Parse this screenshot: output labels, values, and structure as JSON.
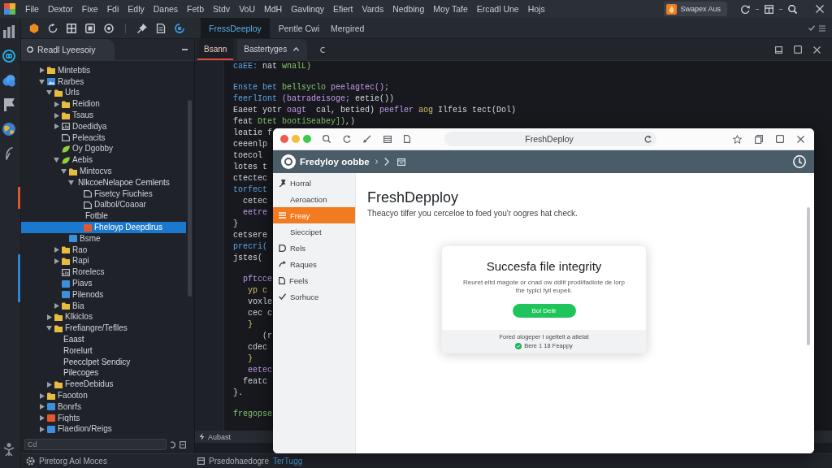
{
  "menubar": {
    "items": [
      "File",
      "Dextor",
      "Fixe",
      "Fdi",
      "Edly",
      "Danes",
      "Fetb",
      "Stdv",
      "VoU",
      "MdH",
      "Gavlinqy",
      "Efiert",
      "Vards",
      "Nedbing",
      "Moy Tafe",
      "Ercadl Une",
      "Hojs"
    ],
    "account": "Swapex Aus"
  },
  "toolbar": {
    "tabs": [
      {
        "label": "FressDeeploy",
        "selected": true
      },
      {
        "label": "Pentle Cwi",
        "selected": false
      },
      {
        "label": "Mergired",
        "selected": false
      }
    ]
  },
  "explorer": {
    "title": "Readl Lyeesoiy",
    "tree": [
      {
        "label": "Mintebtis",
        "kind": "folder",
        "expanded": false,
        "selected": false
      },
      {
        "label": "Rarbes",
        "kind": "image",
        "expanded": true,
        "selected": false,
        "children": [
          {
            "label": "Urls",
            "kind": "folder",
            "expanded": true,
            "selected": false,
            "children": [
              {
                "label": "Reidion",
                "kind": "folder",
                "expanded": false,
                "selected": false
              },
              {
                "label": "Tsaus",
                "kind": "folder",
                "expanded": false,
                "selected": false
              },
              {
                "label": "Doedidya",
                "kind": "chart",
                "expanded": false,
                "selected": false
              },
              {
                "label": "Peleacits",
                "kind": "doc",
                "selected": false
              },
              {
                "label": "Oy Dgobby",
                "kind": "leaf",
                "selected": false
              },
              {
                "label": "Aebis",
                "kind": "leaf",
                "expanded": true,
                "selected": false,
                "children": [
                  {
                    "label": "Mintocvs",
                    "kind": "folder",
                    "expanded": true,
                    "selected": false,
                    "children": [
                      {
                        "label": "NlkcoeNelapoe Cemlents",
                        "kind": "plain",
                        "expanded": true,
                        "selected": false,
                        "children": [
                          {
                            "label": "Fisetcy Fiuchies",
                            "kind": "doc",
                            "selected": false
                          },
                          {
                            "label": "Dalbol/Coaoar",
                            "kind": "doc",
                            "selected": false
                          },
                          {
                            "label": "Fotble",
                            "kind": "plain",
                            "selected": false
                          },
                          {
                            "label": "Fheloyp Deepdlrus",
                            "kind": "red",
                            "selected": true
                          }
                        ]
                      }
                    ]
                  },
                  {
                    "label": "Bsme",
                    "kind": "blue",
                    "selected": false
                  }
                ]
              },
              {
                "label": "Rao",
                "kind": "folder",
                "expanded": false,
                "selected": false
              },
              {
                "label": "Rapi",
                "kind": "folder",
                "expanded": false,
                "selected": false
              },
              {
                "label": "Rorelecs",
                "kind": "chart",
                "selected": false
              },
              {
                "label": "Piavs",
                "kind": "blue",
                "selected": false
              },
              {
                "label": "Pilenods",
                "kind": "blue",
                "selected": false
              },
              {
                "label": "Bia",
                "kind": "folder",
                "expanded": false,
                "selected": false
              }
            ]
          },
          {
            "label": "Klkiclos",
            "kind": "folder",
            "expanded": false,
            "selected": false
          },
          {
            "label": "Frefiangre/Teflles",
            "kind": "folder",
            "expanded": true,
            "selected": false,
            "children": [
              {
                "label": "Eaast",
                "kind": "plain",
                "selected": false
              },
              {
                "label": "Rorelurt",
                "kind": "plain",
                "selected": false
              },
              {
                "label": "Peecclpet Sendicy",
                "kind": "plain",
                "selected": false
              },
              {
                "label": "Pilecoges",
                "kind": "plain",
                "selected": false
              }
            ]
          },
          {
            "label": "FeeeDebidus",
            "kind": "folder",
            "expanded": false,
            "selected": false
          }
        ]
      },
      {
        "label": "Faooton",
        "kind": "folder",
        "expanded": false,
        "selected": false
      },
      {
        "label": "Bonrfs",
        "kind": "blue",
        "expanded": false,
        "selected": false
      },
      {
        "label": "Fiqhts",
        "kind": "red",
        "expanded": false,
        "selected": false
      },
      {
        "label": "Flaedion/Reigs",
        "kind": "blue",
        "expanded": false,
        "selected": false
      }
    ],
    "filter": {
      "placeholder": "Cd"
    }
  },
  "editor": {
    "tabs": [
      {
        "label": "Bsann",
        "selected": true
      },
      {
        "label": "Bastertyges",
        "selected": false
      }
    ],
    "code": [
      {
        "tokens": [
          {
            "text": "caEE:",
            "kind": "kw"
          },
          {
            "text": " nat ",
            "kind": "plain"
          },
          {
            "text": "wnalL)",
            "kind": "str"
          }
        ]
      },
      {
        "blank_before": true,
        "tokens": [
          {
            "text": "Enste ",
            "kind": "kw"
          },
          {
            "text": "bet ",
            "kind": "kw"
          },
          {
            "text": "bellsyclo ",
            "kind": "str"
          },
          {
            "text": "peelagtec();",
            "kind": "fn"
          }
        ]
      },
      {
        "tokens": [
          {
            "text": "feerlIont ",
            "kind": "kw"
          },
          {
            "text": "(batradeisoge; ",
            "kind": "fn"
          },
          {
            "text": "eetie())",
            "kind": "plain"
          }
        ]
      },
      {
        "tokens": [
          {
            "text": "Eaeet yotr ",
            "kind": "plain"
          },
          {
            "text": "oagt ",
            "kind": "fn"
          },
          {
            "text": " cal, betied) ",
            "kind": "plain"
          },
          {
            "text": "peefler ",
            "kind": "fn"
          },
          {
            "text": "aog ",
            "kind": "num"
          },
          {
            "text": "Ilfeis tect(Dol)",
            "kind": "plain"
          }
        ]
      },
      {
        "tokens": [
          {
            "text": "feat ",
            "kind": "plain"
          },
          {
            "text": "Dtet bootiSeabey])",
            "kind": "str"
          },
          {
            "text": ",)",
            "kind": "plain"
          }
        ]
      },
      {
        "tokens": [
          {
            "text": "leatie f",
            "kind": "plain"
          }
        ]
      },
      {
        "tokens": [
          {
            "text": "ceeenlp",
            "kind": "plain"
          }
        ]
      },
      {
        "tokens": [
          {
            "text": "toecol",
            "kind": "plain"
          }
        ]
      },
      {
        "tokens": [
          {
            "text": "lotes t",
            "kind": "plain"
          }
        ]
      },
      {
        "tokens": [
          {
            "text": "ctectec",
            "kind": "plain"
          }
        ]
      },
      {
        "tokens": [
          {
            "text": "torfect",
            "kind": "kw"
          }
        ]
      },
      {
        "tokens": [
          {
            "text": "  cetec",
            "kind": "plain"
          }
        ]
      },
      {
        "tokens": [
          {
            "text": "  eetre",
            "kind": "fn"
          }
        ]
      },
      {
        "tokens": [
          {
            "text": "}",
            "kind": "plain"
          }
        ]
      },
      {
        "tokens": [
          {
            "text": "cetsere",
            "kind": "plain"
          }
        ]
      },
      {
        "tokens": [
          {
            "text": "precri(",
            "kind": "kw"
          }
        ]
      },
      {
        "tokens": [
          {
            "text": "jstes(",
            "kind": "plain"
          }
        ]
      },
      {
        "blank_before": true,
        "tokens": [
          {
            "text": "  pftcce",
            "kind": "fn"
          }
        ]
      },
      {
        "tokens": [
          {
            "text": "   yp c",
            "kind": "num"
          }
        ]
      },
      {
        "tokens": [
          {
            "text": "   voxle",
            "kind": "plain"
          }
        ]
      },
      {
        "tokens": [
          {
            "text": "   cec c",
            "kind": "plain"
          }
        ]
      },
      {
        "tokens": [
          {
            "text": "   }",
            "kind": "num"
          }
        ]
      },
      {
        "tokens": [
          {
            "text": "      (r",
            "kind": "plain"
          }
        ]
      },
      {
        "tokens": [
          {
            "text": "   cdec",
            "kind": "plain"
          }
        ]
      },
      {
        "tokens": [
          {
            "text": "   }",
            "kind": "num"
          }
        ]
      },
      {
        "tokens": [
          {
            "text": "   eetec",
            "kind": "fn"
          }
        ]
      },
      {
        "tokens": [
          {
            "text": "  featc",
            "kind": "plain"
          }
        ]
      },
      {
        "tokens": [
          {
            "text": "}.",
            "kind": "plain"
          }
        ]
      },
      {
        "blank_before": true,
        "tokens": [
          {
            "text": "fregopse",
            "kind": "str"
          }
        ]
      }
    ],
    "panel": "Aubast"
  },
  "browser": {
    "address": "FreshDeploy",
    "app_title": "Fredyloy oobbe",
    "nav": [
      {
        "label": "Horral",
        "kind": "iconed",
        "selected": false
      },
      {
        "label": "Aeroaction",
        "kind": "plain",
        "selected": false
      },
      {
        "label": "Freay",
        "kind": "iconed",
        "selected": true
      },
      {
        "label": "Sieccipet",
        "kind": "plain",
        "selected": false
      },
      {
        "label": "Rels",
        "kind": "iconed",
        "selected": false
      },
      {
        "label": "Raques",
        "kind": "iconed",
        "selected": false
      },
      {
        "label": "Feels",
        "kind": "iconed",
        "selected": false
      },
      {
        "label": "Sorhuce",
        "kind": "iconed",
        "selected": false
      }
    ],
    "heading": "FreshDepploy",
    "subtitle": "Theacyo tilfer you cerceloe to foed you'r oogres hat check.",
    "card": {
      "title": "Succesfa file integrity",
      "text": "Reuret eltd magote or cnad ow ddlit prodilfadiote de lorp the typlcl fyil eupeli.",
      "button": "Bol Dellr",
      "footer": "Fored ologeper I ogeltelt a atietat",
      "status": "Bere 1 18 Feappy"
    }
  },
  "status_bar": {
    "left": "Piretorg Aol Moces",
    "items": [
      {
        "text": "Prsedohaedogre",
        "kind": "plain"
      },
      {
        "text": "TerTugg",
        "kind": "link"
      }
    ]
  }
}
